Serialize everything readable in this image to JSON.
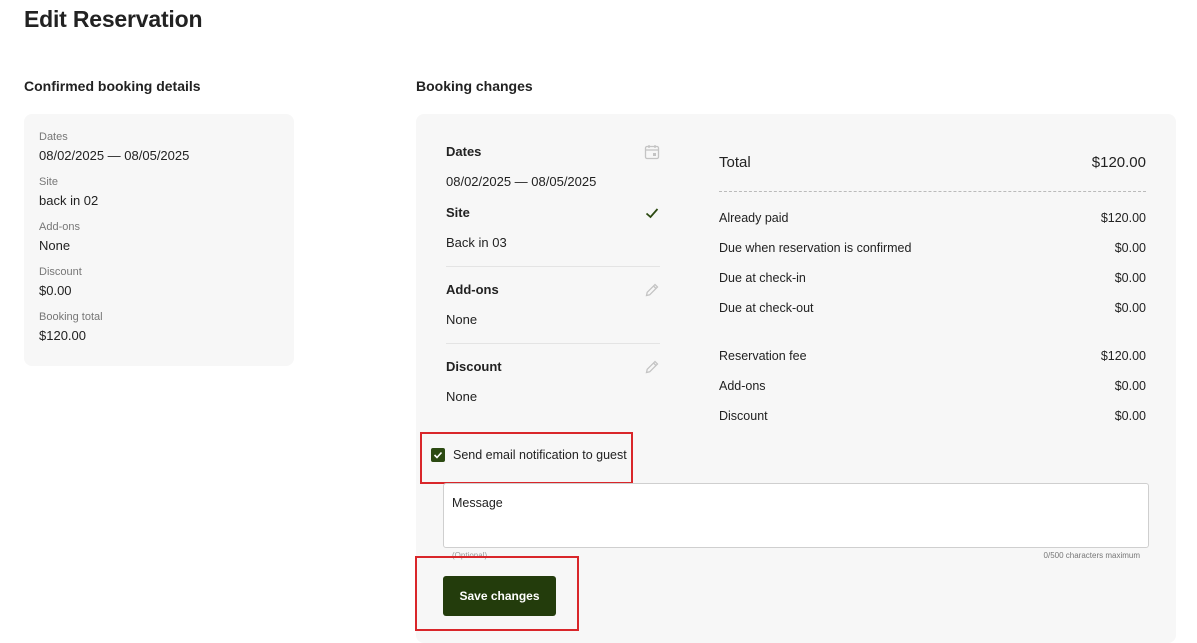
{
  "page": {
    "title": "Edit Reservation"
  },
  "confirmed": {
    "heading": "Confirmed booking details",
    "fields": [
      {
        "label": "Dates",
        "value": "08/02/2025 — 08/05/2025"
      },
      {
        "label": "Site",
        "value": "back in 02"
      },
      {
        "label": "Add-ons",
        "value": "None"
      },
      {
        "label": "Discount",
        "value": "$0.00"
      },
      {
        "label": "Booking total",
        "value": "$120.00"
      }
    ]
  },
  "changes": {
    "heading": "Booking changes",
    "dates": {
      "title": "Dates",
      "value": "08/02/2025 — 08/05/2025",
      "icon": "calendar-icon"
    },
    "site": {
      "title": "Site",
      "value": "Back in 03",
      "icon": "check-icon"
    },
    "addons": {
      "title": "Add-ons",
      "value": "None",
      "icon": "pencil-icon"
    },
    "discount": {
      "title": "Discount",
      "value": "None",
      "icon": "pencil-icon"
    }
  },
  "summary": {
    "total": {
      "label": "Total",
      "value": "$120.00"
    },
    "payments": [
      {
        "label": "Already paid",
        "value": "$120.00"
      },
      {
        "label": "Due when reservation is confirmed",
        "value": "$0.00"
      },
      {
        "label": "Due at check-in",
        "value": "$0.00"
      },
      {
        "label": "Due at check-out",
        "value": "$0.00"
      }
    ],
    "breakdown": [
      {
        "label": "Reservation fee",
        "value": "$120.00"
      },
      {
        "label": "Add-ons",
        "value": "$0.00"
      },
      {
        "label": "Discount",
        "value": "$0.00"
      }
    ]
  },
  "notification": {
    "label": "Send email notification to guest",
    "checked": true
  },
  "message": {
    "placeholder": "Message",
    "hint": "(Optional)",
    "counter": "0/500 characters maximum"
  },
  "actions": {
    "save_label": "Save changes"
  },
  "colors": {
    "accent": "#233c0c",
    "highlight": "#d9262a"
  }
}
